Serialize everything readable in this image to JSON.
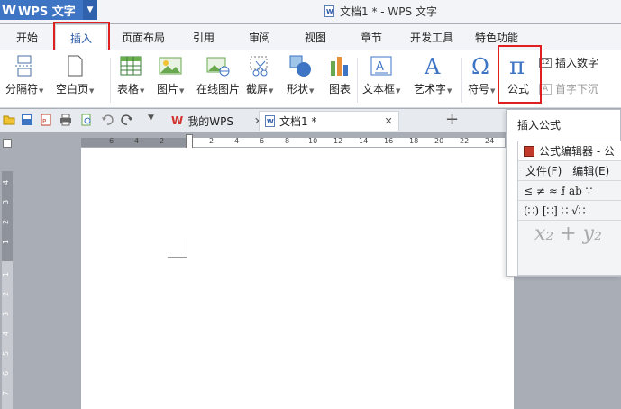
{
  "app": {
    "name": "WPS 文字",
    "window_title": "文档1 * - WPS 文字"
  },
  "tabs": [
    "开始",
    "插入",
    "页面布局",
    "引用",
    "审阅",
    "视图",
    "章节",
    "开发工具",
    "特色功能"
  ],
  "active_tab": "插入",
  "ribbon": {
    "page_break": "分隔符",
    "blank_page": "空白页",
    "table": "表格",
    "picture": "图片",
    "online_picture": "在线图片",
    "screenshot": "截屏",
    "shapes": "形状",
    "chart": "图表",
    "textbox": "文本框",
    "wordart": "艺术字",
    "symbol": "符号",
    "formula": "公式",
    "insert_number": "插入数字",
    "drop_cap": "首字下沉"
  },
  "doc_tabs": [
    {
      "label": "我的WPS",
      "active": false
    },
    {
      "label": "文档1 *",
      "active": true
    }
  ],
  "ruler_top": [
    "6",
    "4",
    "2",
    "2",
    "4",
    "6",
    "8",
    "10",
    "12",
    "14",
    "16",
    "18",
    "20",
    "22",
    "24"
  ],
  "ruler_left": [
    "4",
    "3",
    "2",
    "1",
    "1",
    "2",
    "3",
    "4",
    "5",
    "6",
    "7"
  ],
  "formula_panel": {
    "title": "插入公式",
    "editor_title": "公式编辑器 - 公",
    "menu_file": "文件(F)",
    "menu_edit": "编辑(E)",
    "sym_row1": "≤ ≠ ≈   ⅈ ab ∵",
    "sym_row2": "(∷) [∷]   ∷ √∷",
    "preview": "x₂ + y₂"
  },
  "colors": {
    "highlight": "#e02020",
    "brand": "#3e74c4"
  }
}
